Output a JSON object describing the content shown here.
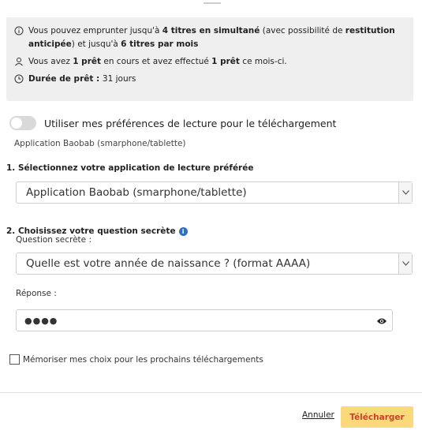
{
  "info": {
    "l1_a": "Vous pouvez emprunter jusqu'à ",
    "l1_b": "4 titres en simultané",
    "l1_c": " (avec possibilité de ",
    "l1_d": "restitution anticipée",
    "l1_e": ") et jusqu'à ",
    "l1_f": "6 titres par mois",
    "l2_a": "Vous avez ",
    "l2_b": "1 prêt",
    "l2_c": " en cours et avez effectué ",
    "l2_d": "1 prêt",
    "l2_e": " ce mois-ci.",
    "l3_a": "Durée de prêt : ",
    "l3_b": "31 jours"
  },
  "toggle": {
    "label": "Utiliser mes préférences de lecture pour le téléchargement",
    "sub": "Application Baobab (smarphone/tablette)",
    "on": false
  },
  "step1": {
    "title": "1. Sélectionnez votre application de lecture préférée",
    "selected": "Application Baobab (smarphone/tablette)"
  },
  "step2": {
    "title": "2. Choisissez votre question secrète",
    "question_label": "Question secrète :",
    "question_selected": "Quelle est votre année de naissance ? (format AAAA)",
    "answer_label": "Réponse :",
    "answer_value": "●●●●"
  },
  "memo": {
    "label": "Mémoriser mes choix pour les prochains téléchargements",
    "checked": false
  },
  "actions": {
    "cancel": "Annuler",
    "download": "Télécharger"
  },
  "colors": {
    "accent_bg": "#f9d97a",
    "accent_text": "#c8442c",
    "info_badge": "#2f6fc6",
    "panel_bg": "#efefef"
  },
  "icons": [
    "info-circle-icon",
    "user-icon",
    "clock-icon",
    "info-badge-icon",
    "chevron-down-icon",
    "eye-icon"
  ]
}
